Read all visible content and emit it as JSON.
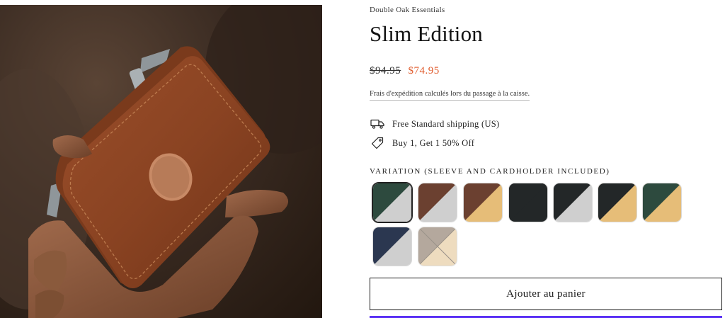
{
  "product": {
    "vendor": "Double Oak Essentials",
    "title": "Slim Edition",
    "compare_price": "$94.95",
    "sale_price": "$74.95",
    "tax_note": "Frais d'expédition calculés lors du passage à la caisse."
  },
  "perks": [
    {
      "icon": "truck-icon",
      "label": "Free Standard shipping (US)"
    },
    {
      "icon": "tag-icon",
      "label": "Buy 1, Get 1 50% Off"
    }
  ],
  "variation": {
    "label": "VARIATION (SLEEVE AND CARDHOLDER INCLUDED)",
    "swatches": [
      {
        "top": "#2d4a3e",
        "bottom": "#cfcfcf",
        "selected": true,
        "available": true
      },
      {
        "top": "#6b4030",
        "bottom": "#cfcfcf",
        "selected": false,
        "available": true
      },
      {
        "top": "#6b4030",
        "bottom": "#e6bd78",
        "selected": false,
        "available": true
      },
      {
        "top": "#232728",
        "bottom": "#232728",
        "selected": false,
        "available": true
      },
      {
        "top": "#232728",
        "bottom": "#cfcfcf",
        "selected": false,
        "available": true
      },
      {
        "top": "#232728",
        "bottom": "#e6bd78",
        "selected": false,
        "available": true
      },
      {
        "top": "#2d4a3e",
        "bottom": "#e6bd78",
        "selected": false,
        "available": true
      },
      {
        "top": "#2b3750",
        "bottom": "#cfcfcf",
        "selected": false,
        "available": true
      },
      {
        "top": "#a89a8c",
        "bottom": "#ecd6b4",
        "selected": false,
        "available": false
      }
    ]
  },
  "actions": {
    "add_to_cart": "Ajouter au panier"
  },
  "colors": {
    "sale": "#e0592a",
    "accent": "#5a31f4"
  }
}
